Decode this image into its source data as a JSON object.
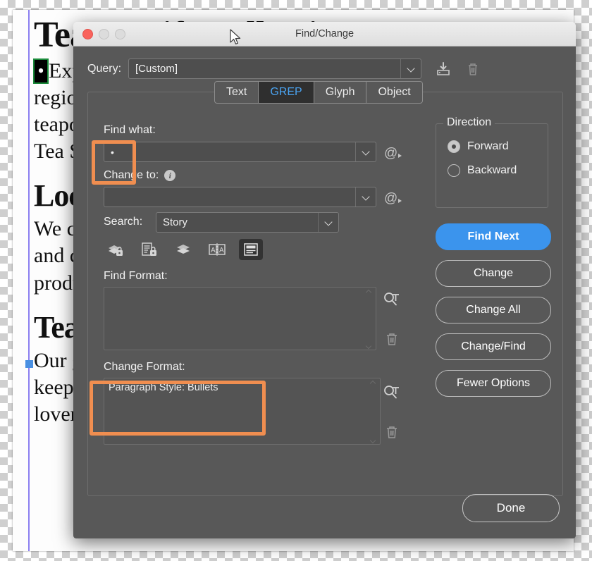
{
  "document": {
    "heading": "Tea & Gift Collection",
    "lines": [
      {
        "type": "bullet",
        "marker": "•",
        "text": "Exp"
      },
      {
        "type": "p",
        "text": "region"
      },
      {
        "type": "p",
        "text": "teapo"
      },
      {
        "type": "p",
        "text": "Tea S"
      },
      {
        "type": "h2",
        "text": "Loc"
      },
      {
        "type": "p",
        "text": "We ca"
      },
      {
        "type": "p",
        "text": "and cl"
      },
      {
        "type": "p",
        "text": "produ"
      },
      {
        "type": "h2",
        "text": "Tea"
      },
      {
        "type": "p",
        "text": "Our g"
      },
      {
        "type": "p",
        "text": "keeps"
      },
      {
        "type": "p",
        "text": "lover"
      }
    ]
  },
  "dialog": {
    "title": "Find/Change",
    "window_controls": {
      "close": "close-button",
      "minimize": "minimize-button",
      "zoom": "zoom-button"
    },
    "query": {
      "label": "Query:",
      "value": "[Custom]",
      "save_icon": "save-query-icon",
      "delete_icon": "delete-query-icon"
    },
    "tabs": [
      {
        "label": "Text",
        "active": false
      },
      {
        "label": "GREP",
        "active": true
      },
      {
        "label": "Glyph",
        "active": false
      },
      {
        "label": "Object",
        "active": false
      }
    ],
    "find_what": {
      "label": "Find what:",
      "value": "•",
      "special_chars_icon": "at-menu-icon"
    },
    "change_to": {
      "label": "Change to:",
      "value": "",
      "info_icon": "info-icon",
      "special_chars_icon": "at-menu-icon"
    },
    "search": {
      "label": "Search:",
      "value": "Story"
    },
    "scope_toggles": [
      {
        "name": "include-locked-layers-icon",
        "active": false
      },
      {
        "name": "include-locked-stories-icon",
        "active": false
      },
      {
        "name": "include-hidden-layers-icon",
        "active": false
      },
      {
        "name": "include-master-pages-icon",
        "active": false
      },
      {
        "name": "include-footnotes-icon",
        "active": true
      }
    ],
    "find_format": {
      "label": "Find Format:",
      "value": "",
      "specify_icon": "specify-attributes-icon",
      "clear_icon": "clear-attributes-icon"
    },
    "change_format": {
      "label": "Change Format:",
      "value": "Paragraph Style: Bullets",
      "specify_icon": "specify-attributes-icon",
      "clear_icon": "clear-attributes-icon"
    },
    "direction": {
      "title": "Direction",
      "options": [
        {
          "label": "Forward",
          "selected": true
        },
        {
          "label": "Backward",
          "selected": false
        }
      ]
    },
    "actions": [
      {
        "label": "Find Next",
        "primary": true
      },
      {
        "label": "Change",
        "primary": false
      },
      {
        "label": "Change All",
        "primary": false
      },
      {
        "label": "Change/Find",
        "primary": false
      },
      {
        "label": "Fewer Options",
        "primary": false
      }
    ],
    "done_label": "Done"
  },
  "annotations": {
    "highlight_color": "#f08e50",
    "accent_color": "#3b94ed",
    "tab_active_text_color": "#4aa3f0",
    "highlights": [
      {
        "name": "find-what-highlight"
      },
      {
        "name": "change-format-highlight"
      }
    ]
  }
}
